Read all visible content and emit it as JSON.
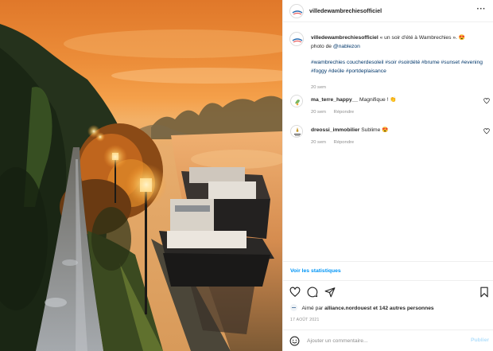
{
  "post": {
    "username": "villedewambrechiesofficiel",
    "more_icon": "more-horizontal-icon"
  },
  "caption": {
    "username": "villedewambrechiesofficiel",
    "text_line1": "« un soir d'été à Wambrechies ».",
    "emoji": "heart-eyes-emoji",
    "photo_prefix": "photo de",
    "photo_credit": "@nablezon",
    "hashtags": "#wambrechies coucherdesoleil #soir #soirdété #brume #sunset #evening #foggy #deûle #portdeplaisance",
    "time": "20 sem"
  },
  "comments": [
    {
      "username": "ma_terre_happy__",
      "text": "Magnifique !",
      "emoji": "clapping-hands-emoji",
      "time": "20 sem",
      "reply_label": "Répondre"
    },
    {
      "username": "dreossi_immobilier",
      "text": "Sublime",
      "emoji": "heart-eyes-emoji",
      "time": "20 sem",
      "reply_label": "Répondre"
    }
  ],
  "insights_label": "Voir les statistiques",
  "actions": {
    "like_icon": "heart-icon",
    "comment_icon": "comment-icon",
    "share_icon": "send-icon",
    "save_icon": "bookmark-icon"
  },
  "likes": {
    "prefix": "Aimé par",
    "user": "alliance.nordouest",
    "suffix": "et 142 autres personnes"
  },
  "date": "17 AOÛT 2021",
  "comment_box": {
    "placeholder": "Ajouter un commentaire...",
    "publish_label": "Publier",
    "emoji_icon": "smiley-icon"
  },
  "colors": {
    "link": "#00376b",
    "accent": "#0095f6",
    "publish_disabled": "#b2dffc",
    "muted": "#8e8e8e"
  }
}
